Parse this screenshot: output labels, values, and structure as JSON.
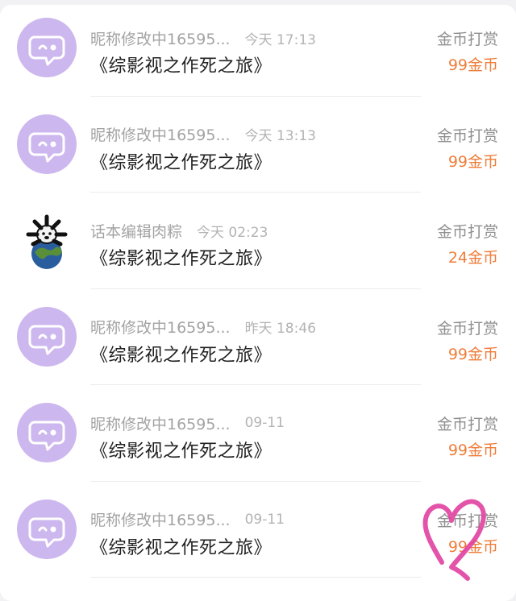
{
  "rows": [
    {
      "avatar": "default-chat-avatar",
      "name": "昵称修改中16595...",
      "time": "今天 17:13",
      "title": "《综影视之作死之旅》",
      "type": "金币打赏",
      "amount": "99金币"
    },
    {
      "avatar": "default-chat-avatar",
      "name": "昵称修改中16595...",
      "time": "今天 13:13",
      "title": "《综影视之作死之旅》",
      "type": "金币打赏",
      "amount": "99金币"
    },
    {
      "avatar": "earth-character-avatar",
      "name": "话本编辑肉粽",
      "time": "今天 02:23",
      "title": "《综影视之作死之旅》",
      "type": "金币打赏",
      "amount": "24金币"
    },
    {
      "avatar": "default-chat-avatar",
      "name": "昵称修改中16595...",
      "time": "昨天 18:46",
      "title": "《综影视之作死之旅》",
      "type": "金币打赏",
      "amount": "99金币"
    },
    {
      "avatar": "default-chat-avatar",
      "name": "昵称修改中16595...",
      "time": "09-11",
      "title": "《综影视之作死之旅》",
      "type": "金币打赏",
      "amount": "99金币"
    },
    {
      "avatar": "default-chat-avatar",
      "name": "昵称修改中16595...",
      "time": "09-11",
      "title": "《综影视之作死之旅》",
      "type": "金币打赏",
      "amount": "99金币"
    }
  ],
  "colors": {
    "accent": "#ef7d3a",
    "avatar_bg": "#cdb7ef",
    "heart": "#e040a0"
  },
  "overlay": {
    "icon": "heart-doodle-icon"
  }
}
